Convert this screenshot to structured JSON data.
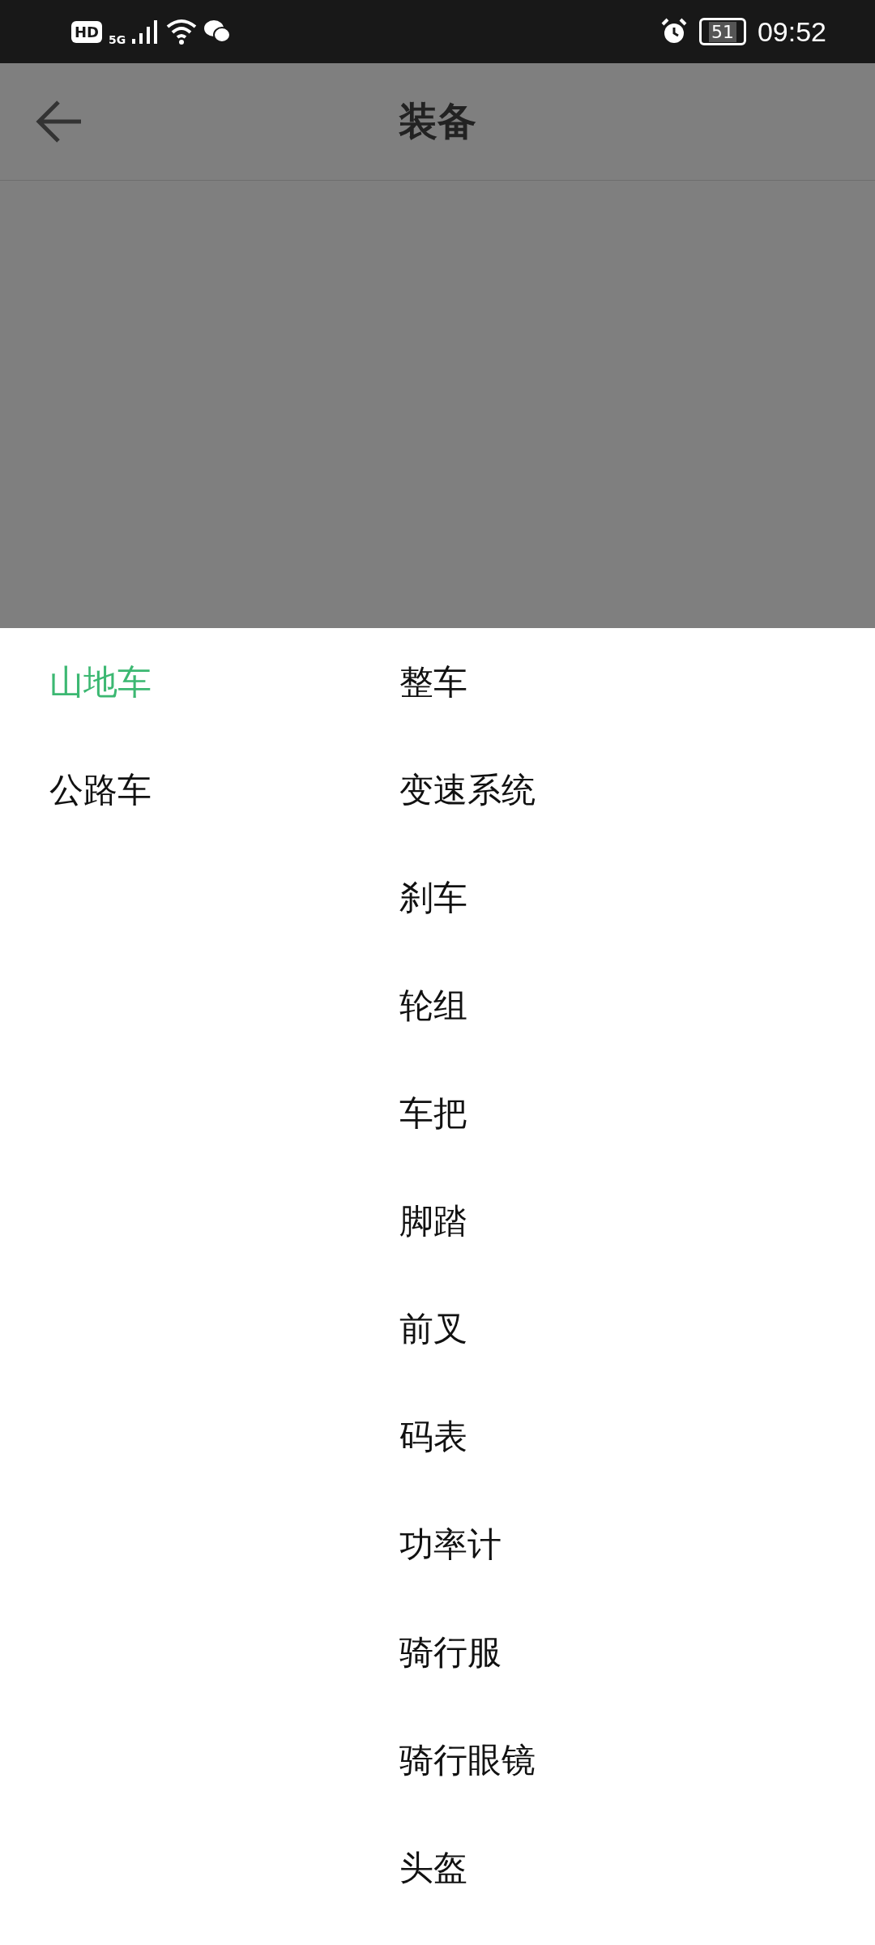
{
  "status_bar": {
    "hd": "HD",
    "network": "5G",
    "battery": "51",
    "time": "09:52"
  },
  "header": {
    "title": "装备"
  },
  "categories": [
    {
      "label": "山地车",
      "selected": true
    },
    {
      "label": "公路车",
      "selected": false
    }
  ],
  "items": [
    "整车",
    "变速系统",
    "刹车",
    "轮组",
    "车把",
    "脚踏",
    "前叉",
    "码表",
    "功率计",
    "骑行服",
    "骑行眼镜",
    "头盔"
  ]
}
